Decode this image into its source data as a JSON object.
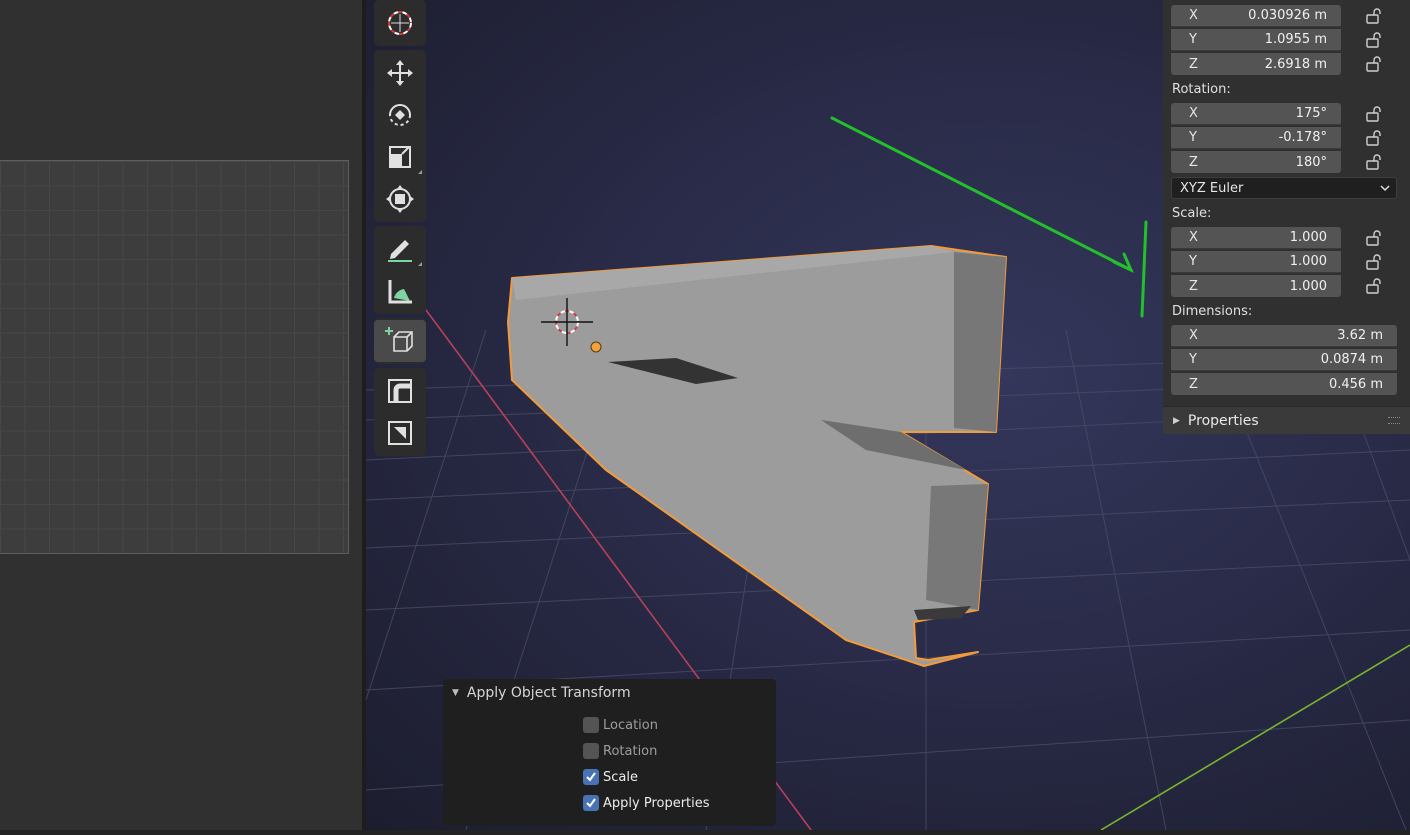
{
  "npanel": {
    "location": [
      {
        "axis": "X",
        "value": "0.030926 m"
      },
      {
        "axis": "Y",
        "value": "1.0955 m"
      },
      {
        "axis": "Z",
        "value": "2.6918 m"
      }
    ],
    "rotation_label": "Rotation:",
    "rotation": [
      {
        "axis": "X",
        "value": "175°"
      },
      {
        "axis": "Y",
        "value": "-0.178°"
      },
      {
        "axis": "Z",
        "value": "180°"
      }
    ],
    "rotation_mode": "XYZ Euler",
    "scale_label": "Scale:",
    "scale": [
      {
        "axis": "X",
        "value": "1.000"
      },
      {
        "axis": "Y",
        "value": "1.000"
      },
      {
        "axis": "Z",
        "value": "1.000"
      }
    ],
    "dimensions_label": "Dimensions:",
    "dimensions": [
      {
        "axis": "X",
        "value": "3.62 m"
      },
      {
        "axis": "Y",
        "value": "0.0874 m"
      },
      {
        "axis": "Z",
        "value": "0.456 m"
      }
    ],
    "properties_label": "Properties"
  },
  "operator": {
    "title": "Apply Object Transform",
    "options": [
      {
        "label": "Location",
        "checked": false
      },
      {
        "label": "Rotation",
        "checked": false
      },
      {
        "label": "Scale",
        "checked": true
      },
      {
        "label": "Apply Properties",
        "checked": true
      }
    ]
  },
  "toolbar": {
    "tools": [
      "cursor-icon",
      "move-icon",
      "rotate-icon",
      "scale-icon",
      "transform-icon",
      "annotate-icon",
      "measure-icon",
      "add-cube-icon",
      "extrude-icon",
      "inset-icon"
    ],
    "active_tool": "add-cube-icon"
  },
  "colors": {
    "selection_outline": "#f29b3a",
    "annotation_arrow": "#22c02a",
    "x_axis": "#b8405a",
    "y_axis": "#7ab52a",
    "checkbox_on": "#4772b3"
  }
}
